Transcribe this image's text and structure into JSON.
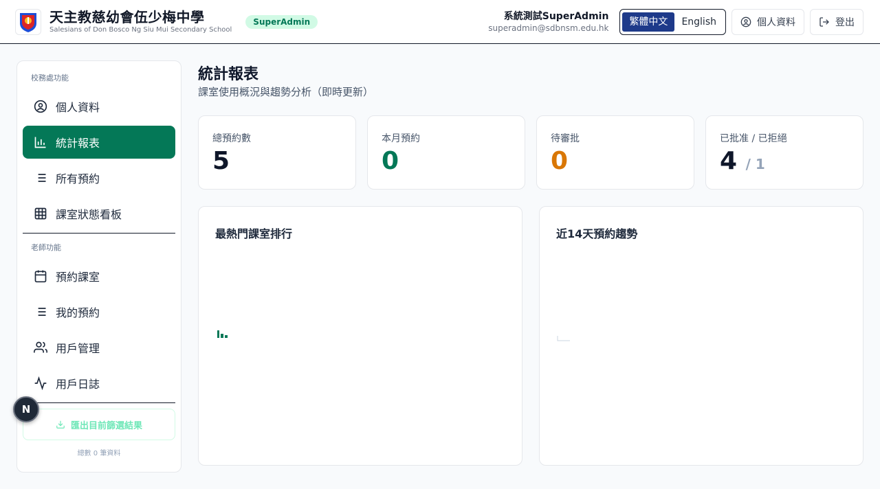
{
  "brand": {
    "name": "天主教慈幼會伍少梅中學",
    "subtitle": "Salesians of Don Bosco Ng Siu Mui Secondary School",
    "role_badge": "SuperAdmin"
  },
  "user": {
    "name": "系統測試SuperAdmin",
    "email": "superadmin@sdbnsm.edu.hk"
  },
  "language": {
    "options": [
      "繁體中文",
      "English"
    ],
    "selected": "繁體中文"
  },
  "header_buttons": {
    "profile": "個人資料",
    "logout": "登出"
  },
  "sidebar": {
    "section_admin": "校務處功能",
    "admin_items": [
      {
        "label": "個人資料",
        "icon": "user-circle-icon"
      },
      {
        "label": "統計報表",
        "icon": "bar-chart-icon",
        "active": true
      },
      {
        "label": "所有預約",
        "icon": "list-icon"
      },
      {
        "label": "課室狀態看板",
        "icon": "grid-icon"
      }
    ],
    "section_teacher": "老師功能",
    "teacher_items": [
      {
        "label": "預約課室",
        "icon": "calendar-icon"
      },
      {
        "label": "我的預約",
        "icon": "list-icon"
      },
      {
        "label": "用戶管理",
        "icon": "users-icon"
      },
      {
        "label": "用戶日誌",
        "icon": "activity-icon"
      }
    ],
    "export_label": "匯出目前篩選結果",
    "count_text": "總數 0 筆資料"
  },
  "fab": {
    "label": "N"
  },
  "page": {
    "title": "統計報表",
    "subtitle": "課室使用概況與趨勢分析（即時更新）"
  },
  "stats": [
    {
      "label": "總預約數",
      "value": "5",
      "color": "#0f172a"
    },
    {
      "label": "本月預約",
      "value": "0",
      "color": "#047857"
    },
    {
      "label": "待審批",
      "value": "0",
      "color": "#d97706"
    },
    {
      "label": "已批准 / 已拒絕",
      "value": "4",
      "sub": "/ 1",
      "color": "#0f172a"
    }
  ],
  "panels": {
    "popular_rooms_title": "最熱門課室排行",
    "trend_title": "近14天預約趨勢"
  },
  "colors": {
    "primary": "#047857",
    "lang_active": "#1e3a8a",
    "pending": "#d97706"
  }
}
